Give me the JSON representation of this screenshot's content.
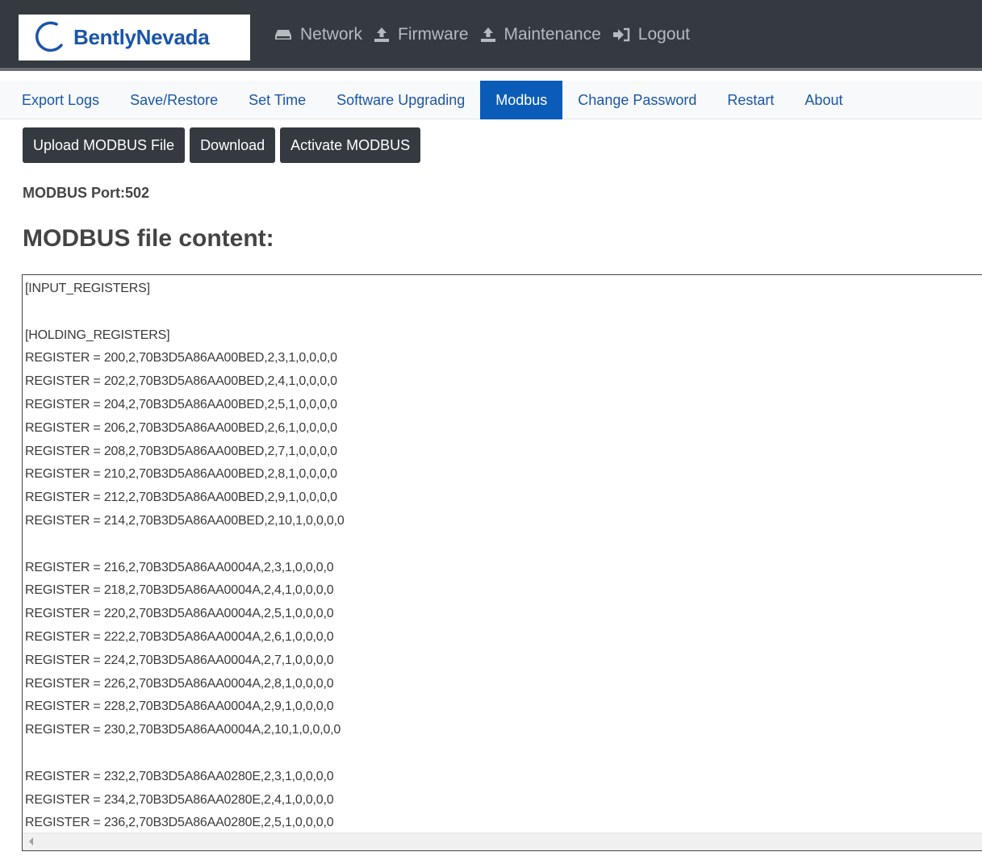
{
  "brand": {
    "name": "BentlyNevada"
  },
  "topnav": [
    {
      "label": "Network",
      "icon": "hdd-icon"
    },
    {
      "label": "Firmware",
      "icon": "upload-icon"
    },
    {
      "label": "Maintenance",
      "icon": "upload-icon"
    },
    {
      "label": "Logout",
      "icon": "sign-out-icon"
    }
  ],
  "subtabs": [
    {
      "label": "Export Logs"
    },
    {
      "label": "Save/Restore"
    },
    {
      "label": "Set Time"
    },
    {
      "label": "Software Upgrading"
    },
    {
      "label": "Modbus",
      "active": true
    },
    {
      "label": "Change Password"
    },
    {
      "label": "Restart"
    },
    {
      "label": "About"
    }
  ],
  "actions": {
    "upload_label": "Upload MODBUS File",
    "download_label": "Download",
    "activate_label": "Activate MODBUS"
  },
  "port_text": "MODBUS Port:502",
  "heading": "MODBUS file content:",
  "file_lines": [
    "[INPUT_REGISTERS]",
    "",
    "[HOLDING_REGISTERS]",
    "REGISTER = 200,2,70B3D5A86AA00BED,2,3,1,0,0,0,0",
    "REGISTER = 202,2,70B3D5A86AA00BED,2,4,1,0,0,0,0",
    "REGISTER = 204,2,70B3D5A86AA00BED,2,5,1,0,0,0,0",
    "REGISTER = 206,2,70B3D5A86AA00BED,2,6,1,0,0,0,0",
    "REGISTER = 208,2,70B3D5A86AA00BED,2,7,1,0,0,0,0",
    "REGISTER = 210,2,70B3D5A86AA00BED,2,8,1,0,0,0,0",
    "REGISTER = 212,2,70B3D5A86AA00BED,2,9,1,0,0,0,0",
    "REGISTER = 214,2,70B3D5A86AA00BED,2,10,1,0,0,0,0",
    "",
    "REGISTER = 216,2,70B3D5A86AA0004A,2,3,1,0,0,0,0",
    "REGISTER = 218,2,70B3D5A86AA0004A,2,4,1,0,0,0,0",
    "REGISTER = 220,2,70B3D5A86AA0004A,2,5,1,0,0,0,0",
    "REGISTER = 222,2,70B3D5A86AA0004A,2,6,1,0,0,0,0",
    "REGISTER = 224,2,70B3D5A86AA0004A,2,7,1,0,0,0,0",
    "REGISTER = 226,2,70B3D5A86AA0004A,2,8,1,0,0,0,0",
    "REGISTER = 228,2,70B3D5A86AA0004A,2,9,1,0,0,0,0",
    "REGISTER = 230,2,70B3D5A86AA0004A,2,10,1,0,0,0,0",
    "",
    "REGISTER = 232,2,70B3D5A86AA0280E,2,3,1,0,0,0,0",
    "REGISTER = 234,2,70B3D5A86AA0280E,2,4,1,0,0,0,0",
    "REGISTER = 236,2,70B3D5A86AA0280E,2,5,1,0,0,0,0"
  ],
  "colors": {
    "navbar_bg": "#343a40",
    "accent": "#0b5cb8",
    "brand_blue": "#1a56a8"
  }
}
